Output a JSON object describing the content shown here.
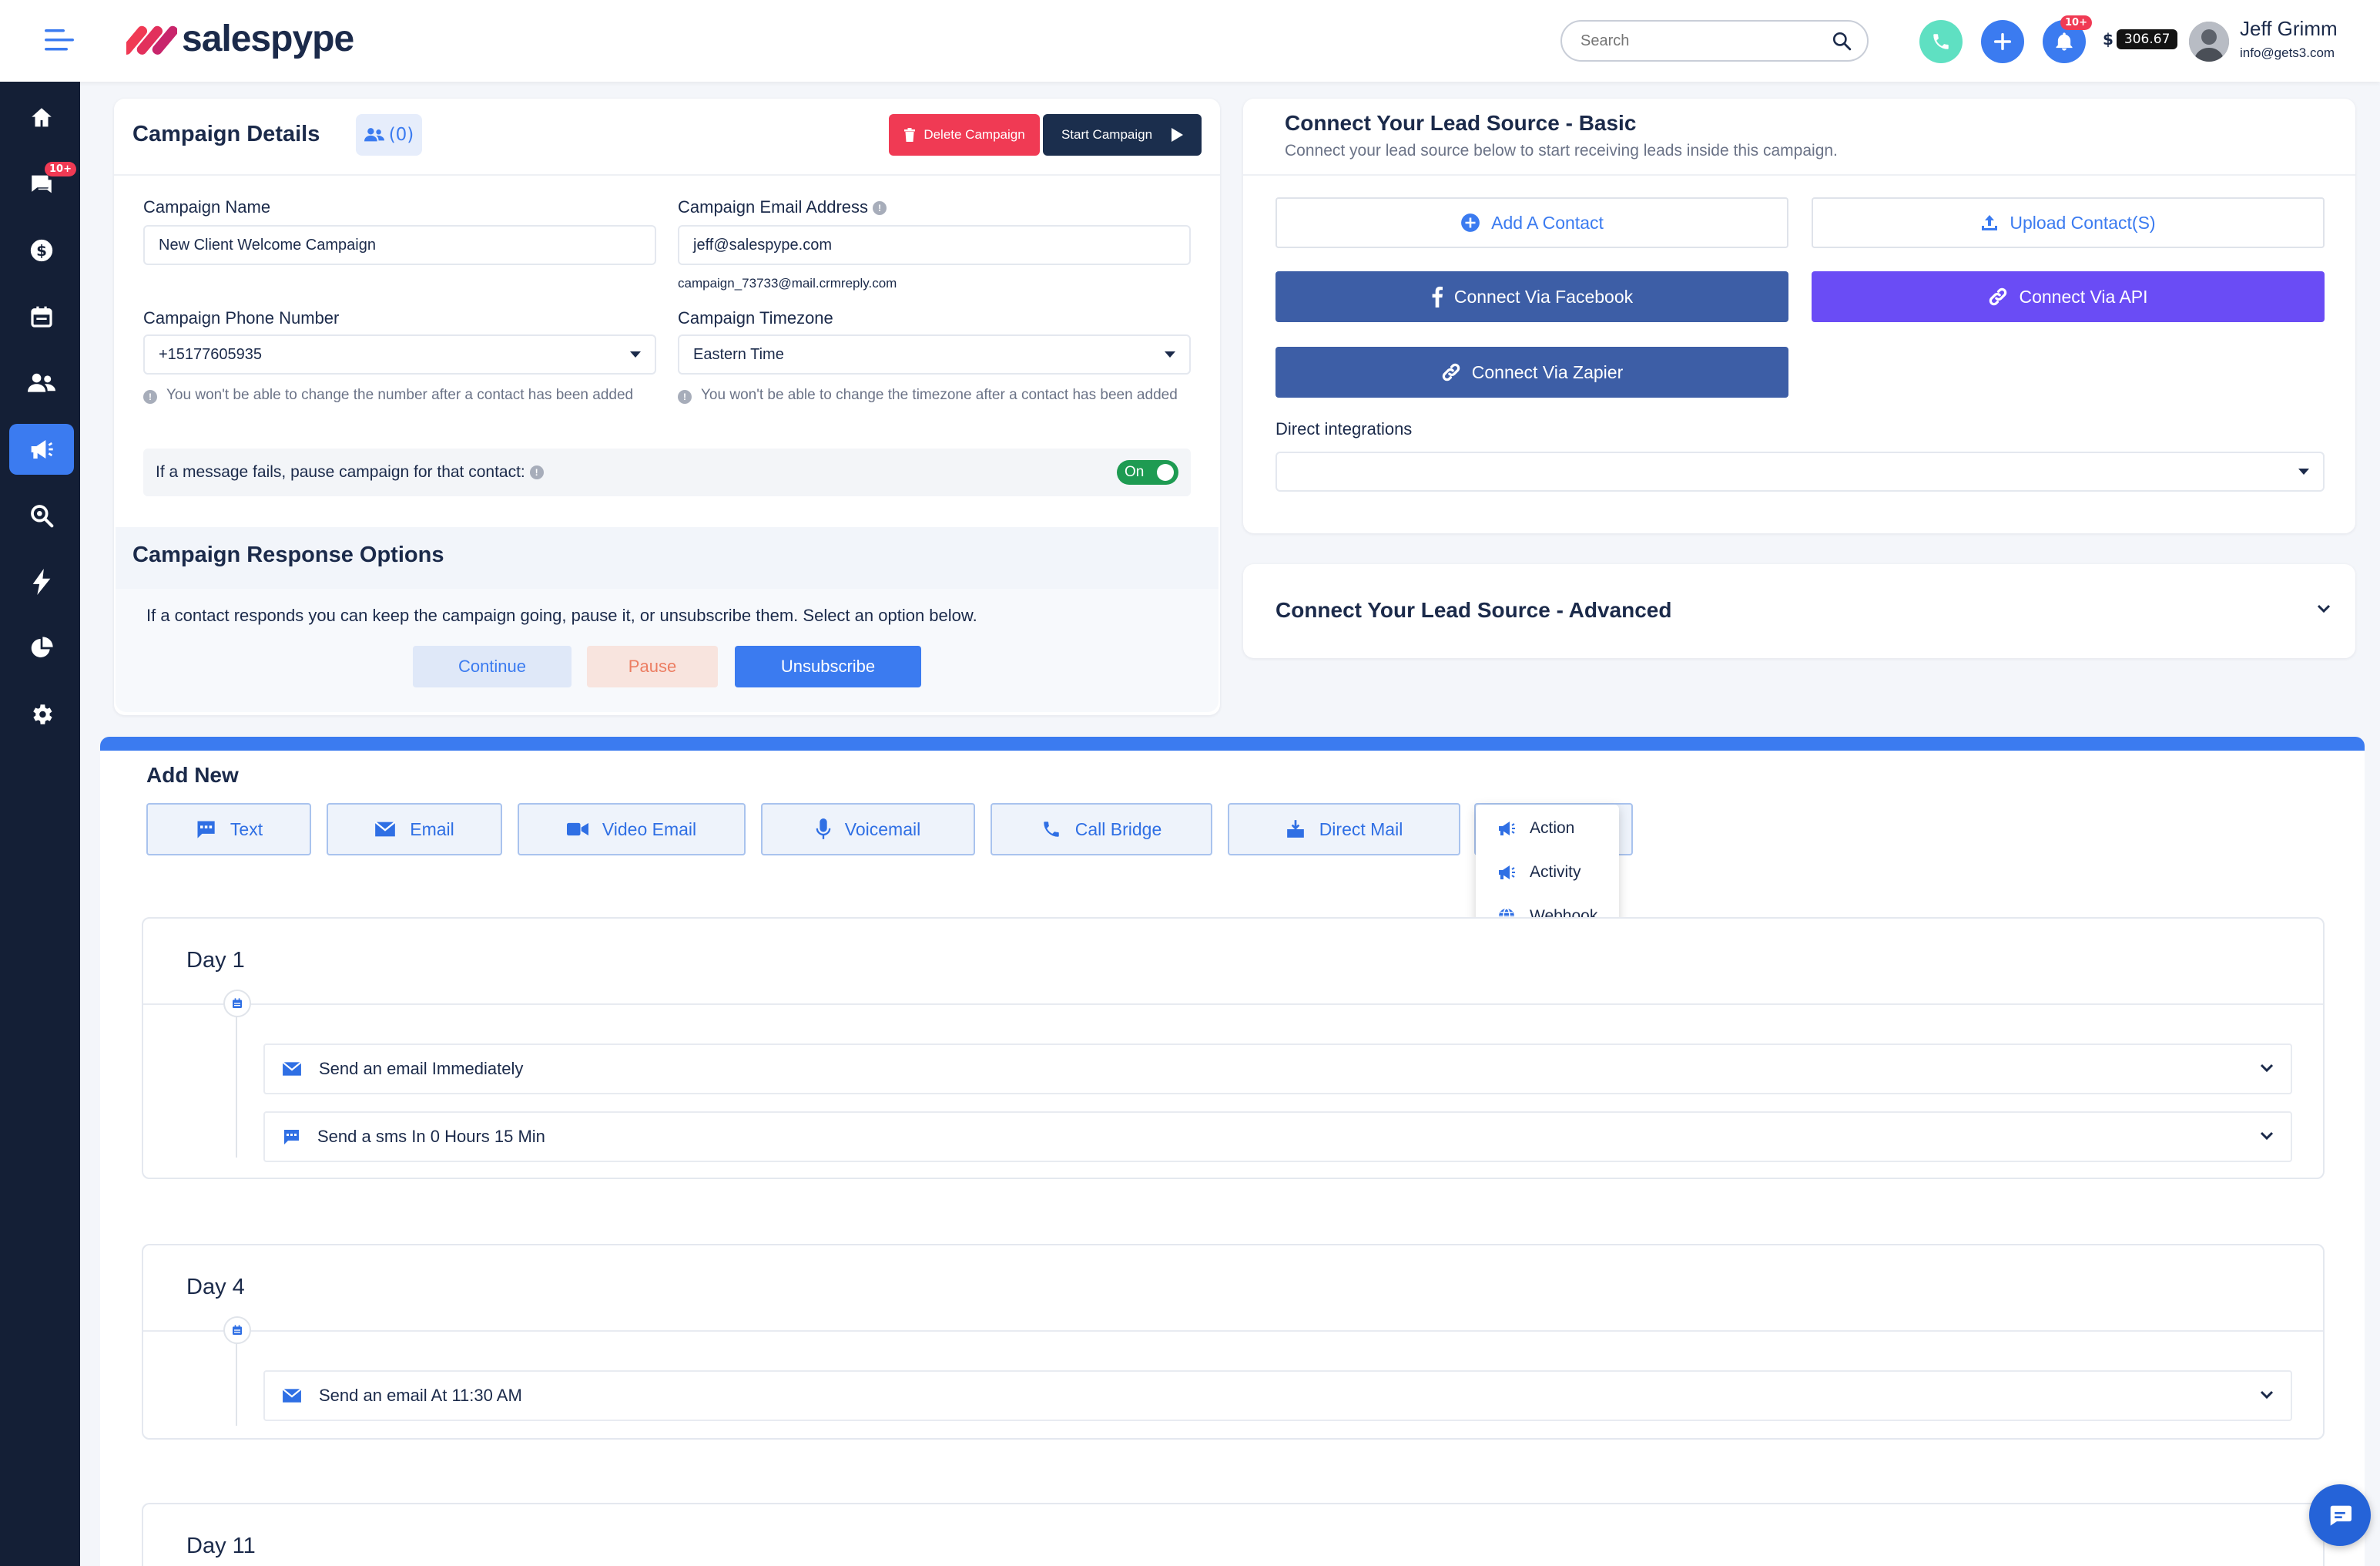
{
  "header": {
    "brand": "salespype",
    "search_placeholder": "Search",
    "notifications_badge": "10+",
    "balance_currency": "$",
    "balance": "306.67",
    "user_name": "Jeff Grimm",
    "user_email": "info@gets3.com"
  },
  "sidebar": {
    "messages_badge": "10+",
    "items": [
      "home-icon",
      "messages-icon",
      "dollar-icon",
      "calendar-icon",
      "people-icon",
      "megaphone-icon",
      "search-icon",
      "bolt-icon",
      "pie-chart-icon",
      "gear-icon"
    ],
    "active_index": 5
  },
  "campaign": {
    "title": "Campaign Details",
    "contacts_count": "(0)",
    "delete_label": "Delete Campaign",
    "start_label": "Start Campaign",
    "name_label": "Campaign Name",
    "name_value": "New Client Welcome Campaign",
    "email_label": "Campaign Email Address",
    "email_value": "jeff@salespype.com",
    "email_alias": "campaign_73733@mail.crmreply.com",
    "phone_label": "Campaign Phone Number",
    "phone_value": "+15177605935",
    "phone_hint": "You won't be able to change the number after a contact has been added",
    "timezone_label": "Campaign Timezone",
    "timezone_value": "Eastern Time",
    "timezone_hint": "You won't be able to change the timezone after a contact has been added",
    "pause_label": "If a message fails, pause campaign for that contact:",
    "pause_toggle": "On"
  },
  "response_options": {
    "title": "Campaign Response Options",
    "description": "If a contact responds you can keep the campaign going, pause it, or unsubscribe them. Select an option below.",
    "continue_label": "Continue",
    "pause_label": "Pause",
    "unsubscribe_label": "Unsubscribe"
  },
  "lead_source": {
    "title": "Connect Your Lead Source - Basic",
    "subtitle": "Connect your lead source below to start receiving leads inside this campaign.",
    "add_contact": "Add A Contact",
    "upload_contacts": "Upload Contact(S)",
    "facebook": "Connect Via Facebook",
    "api": "Connect Via API",
    "zapier": "Connect Via Zapier",
    "direct_label": "Direct integrations",
    "direct_value": "",
    "advanced_title": "Connect Your Lead Source - Advanced"
  },
  "add_new": {
    "title": "Add New",
    "buttons": [
      "Text",
      "Email",
      "Video Email",
      "Voicemail",
      "Call Bridge",
      "Direct Mail"
    ],
    "menu": [
      "Action",
      "Activity",
      "Webhook"
    ]
  },
  "days": [
    {
      "title": "Day 1",
      "steps": [
        {
          "icon": "email-icon",
          "text": "Send an email Immediately"
        },
        {
          "icon": "sms-icon",
          "text": "Send a sms In 0 Hours 15 Min"
        }
      ]
    },
    {
      "title": "Day 4",
      "steps": [
        {
          "icon": "email-icon",
          "text": "Send an email At 11:30 AM"
        }
      ]
    },
    {
      "title": "Day 11",
      "steps": []
    }
  ],
  "colors": {
    "sidebar": "#141f36",
    "accent": "#3b7bf0",
    "danger": "#f03a54",
    "navy": "#1b2e4d",
    "facebook": "#3d5ea6",
    "api": "#6a4cf5",
    "toggle": "#1e9b52"
  }
}
